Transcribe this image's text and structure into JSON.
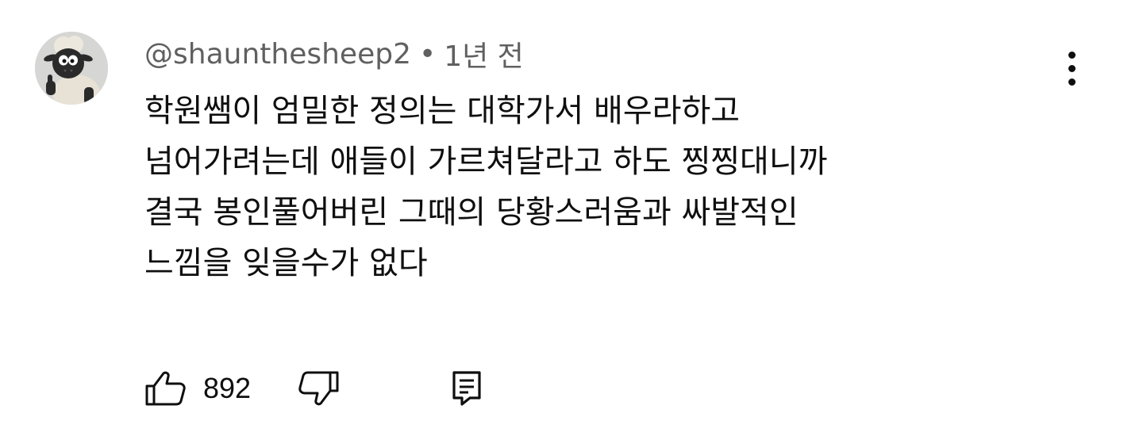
{
  "comment": {
    "author": "@shauntheshee­p2",
    "separator": "•",
    "time": "1년 전",
    "text_lines": [
      "학원쌤이 엄밀한 정의는 대학가서 배우라하고",
      "넘어가려는데 애들이 가르쳐달라고 하도 찡찡대니까",
      "결국 봉인풀어버린 그때의 당황스러움과 싸발적인",
      "느낌을 잊을수가 없다"
    ],
    "likes": "892",
    "icons": {
      "avatar": "sheep-avatar",
      "like": "thumbs-up-icon",
      "dislike": "thumbs-down-icon",
      "reply": "reply-comment-icon",
      "menu": "more-vert-icon"
    }
  }
}
